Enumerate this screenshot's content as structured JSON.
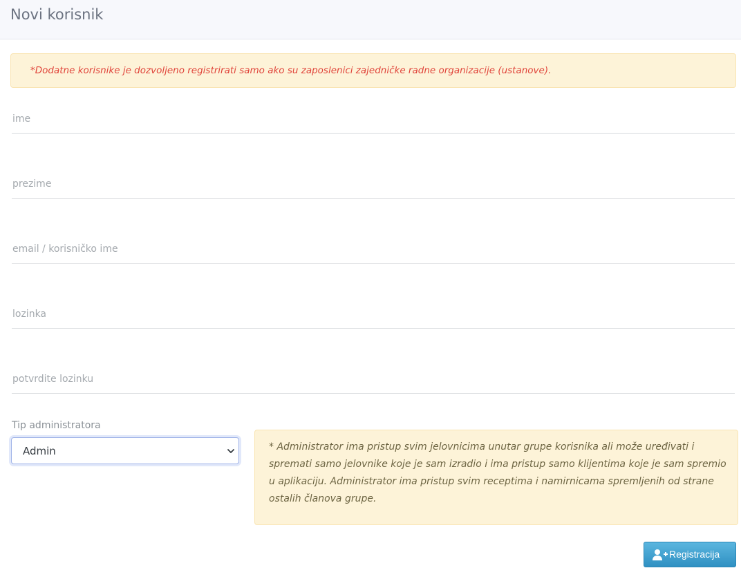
{
  "header": {
    "title": "Novi korisnik"
  },
  "notice": {
    "text": "*Dodatne korisnike je dozvoljeno registrirati samo ako su zaposlenici zajedničke radne organizacije (ustanove)."
  },
  "form": {
    "first_name": {
      "placeholder": "ime",
      "value": ""
    },
    "last_name": {
      "placeholder": "prezime",
      "value": ""
    },
    "email": {
      "placeholder": "email / korisničko ime",
      "value": ""
    },
    "password": {
      "placeholder": "lozinka",
      "value": ""
    },
    "password_confirm": {
      "placeholder": "potvrdite lozinku",
      "value": ""
    },
    "admin_type": {
      "label": "Tip administratora",
      "selected": "Admin"
    }
  },
  "info": {
    "text": "* Administrator ima pristup svim jelovnicima unutar grupe korisnika ali može uređivati i spremati samo jelovnike koje je sam izradio i ima pristup samo klijentima koje je sam spremio u aplikaciju. Administrator ima pristup svim receptima i namirnicama spremljenih od strane ostalih članova grupe."
  },
  "actions": {
    "register_label": "Registracija",
    "register_icon": "user-plus-icon"
  },
  "colors": {
    "notice_bg": "#fdf3d8",
    "notice_text": "#e0443a",
    "button_bg": "#3a9fd0"
  }
}
